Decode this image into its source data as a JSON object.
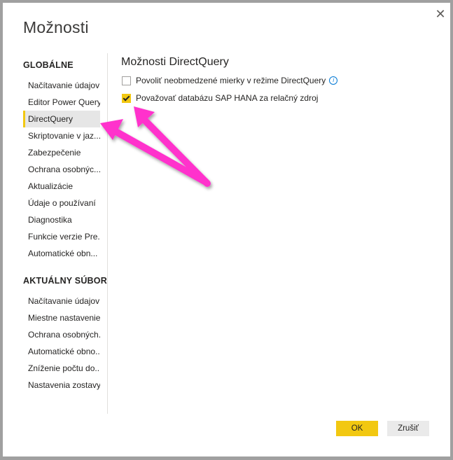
{
  "dialog": {
    "title": "Možnosti",
    "close_icon": "close-icon"
  },
  "sidebar": {
    "global_heading": "GLOBÁLNE",
    "global_items": [
      {
        "label": "Načítavanie údajov",
        "active": false
      },
      {
        "label": "Editor Power Query",
        "active": false
      },
      {
        "label": "DirectQuery",
        "active": true
      },
      {
        "label": "Skriptovanie v jaz...",
        "active": false
      },
      {
        "label": "Zabezpečenie",
        "active": false
      },
      {
        "label": "Ochrana osobnýc...",
        "active": false
      },
      {
        "label": "Aktualizácie",
        "active": false
      },
      {
        "label": "Údaje o používaní",
        "active": false
      },
      {
        "label": "Diagnostika",
        "active": false
      },
      {
        "label": "Funkcie verzie Pre...",
        "active": false
      },
      {
        "label": "Automatické obn...",
        "active": false
      }
    ],
    "file_heading": "AKTUÁLNY SÚBOR",
    "file_items": [
      {
        "label": "Načítavanie údajov"
      },
      {
        "label": "Miestne nastavenie"
      },
      {
        "label": "Ochrana osobných..."
      },
      {
        "label": "Automatické obno..."
      },
      {
        "label": "Zníženie počtu do..."
      },
      {
        "label": "Nastavenia zostavy"
      }
    ]
  },
  "content": {
    "title": "Možnosti DirectQuery",
    "options": [
      {
        "label": "Povoliť neobmedzené mierky v režime DirectQuery",
        "checked": false,
        "info_icon": "info-icon",
        "info_glyph": "i"
      },
      {
        "label": "Považovať databázu SAP HANA za relačný zdroj",
        "checked": true
      }
    ]
  },
  "footer": {
    "ok_label": "OK",
    "cancel_label": "Zrušiť"
  },
  "annotations": {
    "arrow_color": "#ff33cc",
    "accent_color": "#f2c811"
  }
}
